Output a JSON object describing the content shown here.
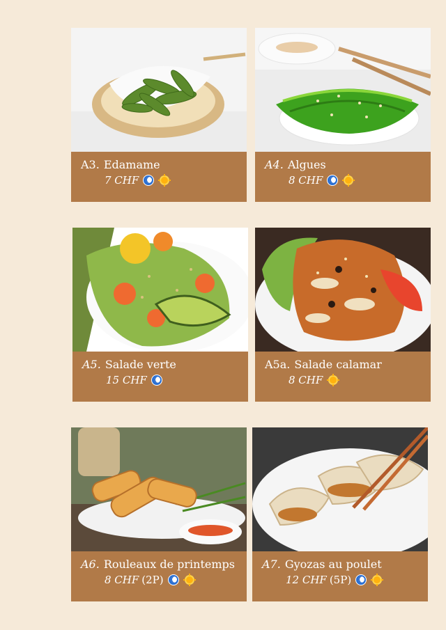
{
  "items": [
    {
      "code": "A3.",
      "name": "Edamame",
      "price": "7 CHF",
      "extra": "",
      "dinner": true,
      "lunch": true
    },
    {
      "code": "A4.",
      "name": "Algues",
      "price": "8 CHF",
      "extra": "",
      "dinner": true,
      "lunch": true
    },
    {
      "code": "A5.",
      "name": "Salade verte",
      "price": "15 CHF",
      "extra": "",
      "dinner": true,
      "lunch": false
    },
    {
      "code": "A5a.",
      "name": "Salade calamar",
      "price": "8 CHF",
      "extra": "",
      "dinner": false,
      "lunch": true
    },
    {
      "code": "A6.",
      "name": "Rouleaux de printemps",
      "price": "8 CHF",
      "extra": "(2P)",
      "dinner": true,
      "lunch": true
    },
    {
      "code": "A7.",
      "name": "Gyozas au poulet",
      "price": "12 CHF",
      "extra": "(5P)",
      "dinner": true,
      "lunch": true
    }
  ],
  "icons": {
    "dinner": "moon-icon",
    "lunch": "sun-icon"
  },
  "colors": {
    "background": "#f6ead9",
    "caption": "#b17a48",
    "moon": "#2b6fd1",
    "sun": "#ffb20f"
  }
}
